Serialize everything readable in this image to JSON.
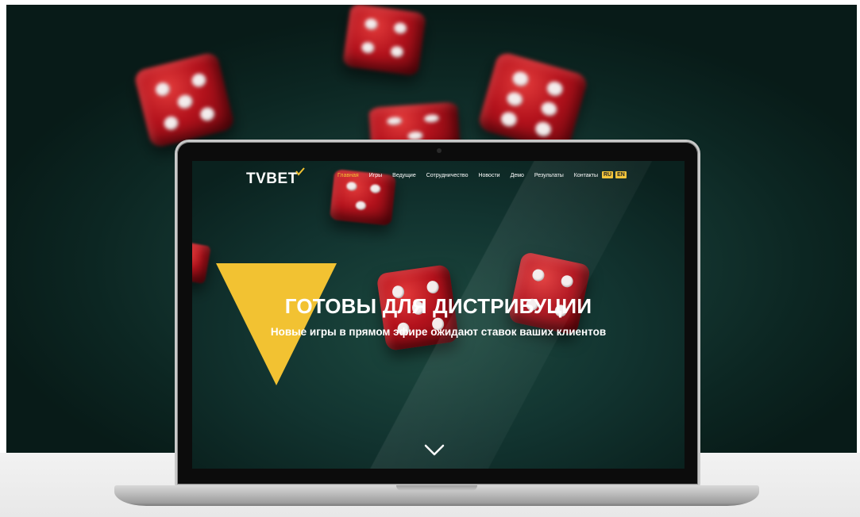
{
  "site": {
    "logo_text": "TVBET",
    "nav": [
      {
        "label": "Главная",
        "active": true
      },
      {
        "label": "Игры"
      },
      {
        "label": "Ведущие"
      },
      {
        "label": "Сотрудничество"
      },
      {
        "label": "Новости"
      },
      {
        "label": "Демо"
      },
      {
        "label": "Результаты"
      },
      {
        "label": "Контакты"
      }
    ],
    "languages": [
      "RU",
      "EN"
    ],
    "hero": {
      "title": "ГОТОВЫ ДЛЯ ДИСТРИБУЦИИ",
      "subtitle": "Новые игры в прямом эфире ожидают ставок ваших клиентов"
    },
    "scroll_icon": "chevron-down-icon"
  },
  "colors": {
    "accent": "#f2c232",
    "background": "#123430",
    "dice": "#b3121c"
  }
}
